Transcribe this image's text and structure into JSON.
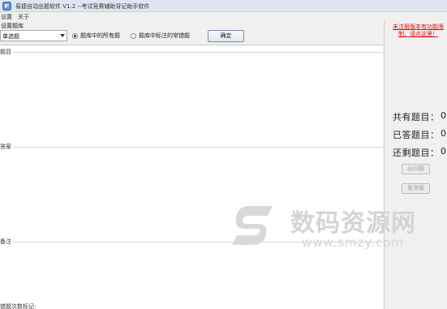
{
  "window": {
    "title": "易捷自动出题软件 V1.2   --考试竞赛辅助背记助手软件"
  },
  "menu": {
    "items": [
      {
        "label": "设置"
      },
      {
        "label": "关于"
      }
    ]
  },
  "setup": {
    "group_label": "设置题库",
    "question_type": "单选题",
    "radio_all": "题库中的所有题",
    "radio_marked": "题库中标注的常错题",
    "radio_selected": "all",
    "confirm_label": "确定"
  },
  "sections": {
    "question": "题目",
    "answer": "答案",
    "note": "备注",
    "wrong_count": "错题次数标记:"
  },
  "right": {
    "register_link": "未注册版本有功能限制，请点这里！",
    "stats": [
      {
        "label": "共有题目：",
        "value": "0"
      },
      {
        "label": "已答题目：",
        "value": "0"
      },
      {
        "label": "还剩题目：",
        "value": "0"
      }
    ],
    "next_button": "出问题",
    "answer_button": "看答案"
  },
  "watermark": {
    "text": "数码资源网",
    "url": "www.smzy.com"
  },
  "colors": {
    "link": "#e01010",
    "radio_selected": "#1e3a8a",
    "watermark": "#cfcfcf"
  }
}
